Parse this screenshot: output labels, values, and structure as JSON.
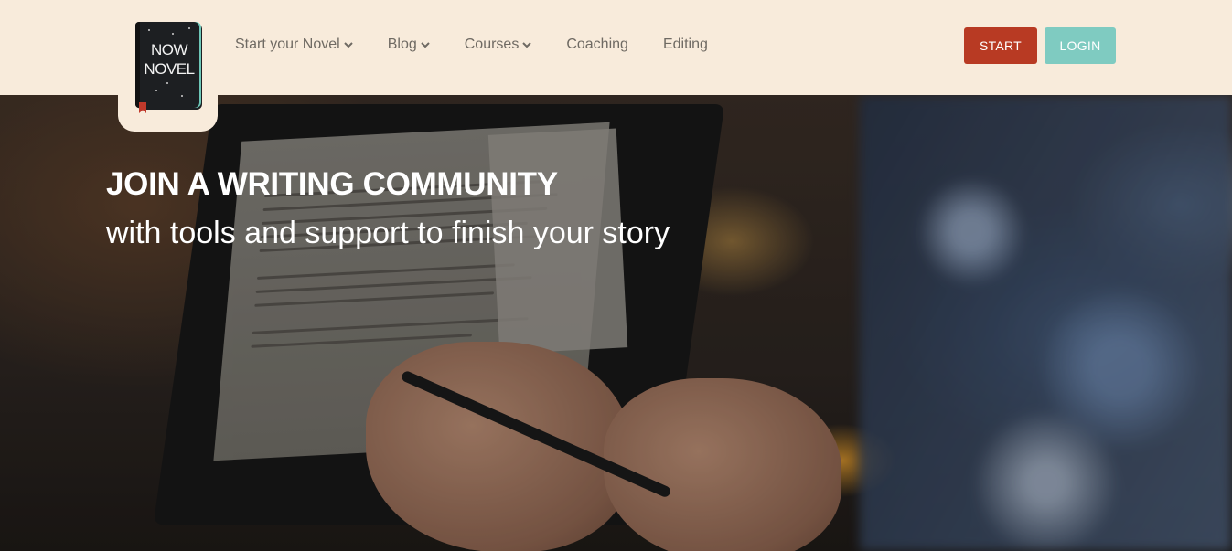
{
  "logo": {
    "line1": "NOW",
    "line2": "NOVEL"
  },
  "nav": {
    "items": [
      {
        "label": "Start your Novel",
        "dropdown": true
      },
      {
        "label": "Blog",
        "dropdown": true
      },
      {
        "label": "Courses",
        "dropdown": true
      },
      {
        "label": "Coaching",
        "dropdown": false
      },
      {
        "label": "Editing",
        "dropdown": false
      }
    ]
  },
  "buttons": {
    "start": "START",
    "login": "LOGIN"
  },
  "hero": {
    "title": "JOIN A WRITING COMMUNITY",
    "subtitle": "with tools and support to finish your story"
  },
  "colors": {
    "header_bg": "#f8ebdb",
    "start_bg": "#b83a23",
    "login_bg": "#7fcbc1",
    "nav_text": "#6f6a63"
  }
}
